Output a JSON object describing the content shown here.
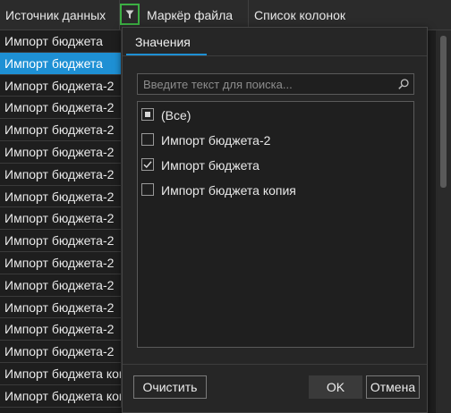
{
  "grid": {
    "columns": [
      "Источник данных",
      "Маркёр файла",
      "Список колонок"
    ],
    "rows": [
      "Импорт бюджета",
      "Импорт бюджета",
      "Импорт бюджета-2",
      "Импорт бюджета-2",
      "Импорт бюджета-2",
      "Импорт бюджета-2",
      "Импорт бюджета-2",
      "Импорт бюджета-2",
      "Импорт бюджета-2",
      "Импорт бюджета-2",
      "Импорт бюджета-2",
      "Импорт бюджета-2",
      "Импорт бюджета-2",
      "Импорт бюджета-2",
      "Импорт бюджета-2",
      "Импорт бюджета копия",
      "Импорт бюджета копия"
    ],
    "selected_row": 1,
    "colors": {
      "selection": "#1e90d4",
      "filter_highlight": "#3cb043"
    }
  },
  "filter_popup": {
    "tab_label": "Значения",
    "search_placeholder": "Введите текст для поиска...",
    "items": [
      {
        "label": "(Все)",
        "state": "indeterminate"
      },
      {
        "label": "Импорт бюджета-2",
        "state": "unchecked"
      },
      {
        "label": "Импорт бюджета",
        "state": "checked"
      },
      {
        "label": "Импорт бюджета копия",
        "state": "unchecked"
      }
    ],
    "clear_label": "Очистить",
    "ok_label": "OK",
    "cancel_label": "Отмена"
  },
  "icons": [
    "filter-icon",
    "search-icon",
    "checkmark-icon"
  ]
}
